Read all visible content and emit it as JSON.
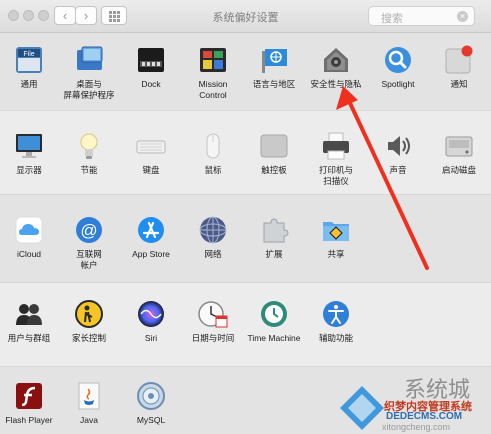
{
  "window": {
    "title": "系统偏好设置",
    "search_placeholder": "搜索",
    "nav_back": "‹",
    "nav_forward": "›"
  },
  "rows": [
    {
      "items": [
        {
          "id": "general",
          "label": "通用",
          "icon": "general-icon"
        },
        {
          "id": "desktop",
          "label": "桌面与\n屏幕保护程序",
          "icon": "desktop-screensaver-icon"
        },
        {
          "id": "dock",
          "label": "Dock",
          "icon": "dock-icon"
        },
        {
          "id": "mission",
          "label": "Mission\nControl",
          "icon": "mission-control-icon"
        },
        {
          "id": "language",
          "label": "语言与地区",
          "icon": "language-region-icon"
        },
        {
          "id": "security",
          "label": "安全性与隐私",
          "icon": "security-privacy-icon"
        },
        {
          "id": "spotlight",
          "label": "Spotlight",
          "icon": "spotlight-icon"
        },
        {
          "id": "notifications",
          "label": "通知",
          "icon": "notifications-icon"
        }
      ]
    },
    {
      "items": [
        {
          "id": "displays",
          "label": "显示器",
          "icon": "displays-icon"
        },
        {
          "id": "energy",
          "label": "节能",
          "icon": "energy-saver-icon"
        },
        {
          "id": "keyboard",
          "label": "键盘",
          "icon": "keyboard-icon"
        },
        {
          "id": "mouse",
          "label": "鼠标",
          "icon": "mouse-icon"
        },
        {
          "id": "trackpad",
          "label": "触控板",
          "icon": "trackpad-icon"
        },
        {
          "id": "printers",
          "label": "打印机与\n扫描仪",
          "icon": "printers-scanners-icon"
        },
        {
          "id": "sound",
          "label": "声音",
          "icon": "sound-icon"
        },
        {
          "id": "startup",
          "label": "启动磁盘",
          "icon": "startup-disk-icon"
        }
      ]
    },
    {
      "items": [
        {
          "id": "icloud",
          "label": "iCloud",
          "icon": "icloud-icon"
        },
        {
          "id": "internet",
          "label": "互联网\n帐户",
          "icon": "internet-accounts-icon"
        },
        {
          "id": "appstore",
          "label": "App Store",
          "icon": "app-store-icon"
        },
        {
          "id": "network",
          "label": "网络",
          "icon": "network-icon"
        },
        {
          "id": "extensions",
          "label": "扩展",
          "icon": "extensions-icon"
        },
        {
          "id": "sharing",
          "label": "共享",
          "icon": "sharing-icon"
        }
      ]
    },
    {
      "items": [
        {
          "id": "users",
          "label": "用户与群组",
          "icon": "users-groups-icon"
        },
        {
          "id": "parental",
          "label": "家长控制",
          "icon": "parental-controls-icon"
        },
        {
          "id": "siri",
          "label": "Siri",
          "icon": "siri-icon"
        },
        {
          "id": "datetime",
          "label": "日期与时间",
          "icon": "date-time-icon"
        },
        {
          "id": "timemachine",
          "label": "Time Machine",
          "icon": "time-machine-icon"
        },
        {
          "id": "accessibility",
          "label": "辅助功能",
          "icon": "accessibility-icon"
        }
      ]
    },
    {
      "items": [
        {
          "id": "flash",
          "label": "Flash Player",
          "icon": "flash-player-icon"
        },
        {
          "id": "java",
          "label": "Java",
          "icon": "java-icon"
        },
        {
          "id": "mysql",
          "label": "MySQL",
          "icon": "mysql-icon"
        }
      ]
    }
  ],
  "watermark": {
    "brand": "系统城",
    "site_cn": "织梦内容管理系统",
    "site_en": "DEDECMS.COM",
    "url": "xitongcheng.com"
  },
  "colors": {
    "annotation_arrow": "#f0301e",
    "notification_badge": "#e5392f"
  }
}
